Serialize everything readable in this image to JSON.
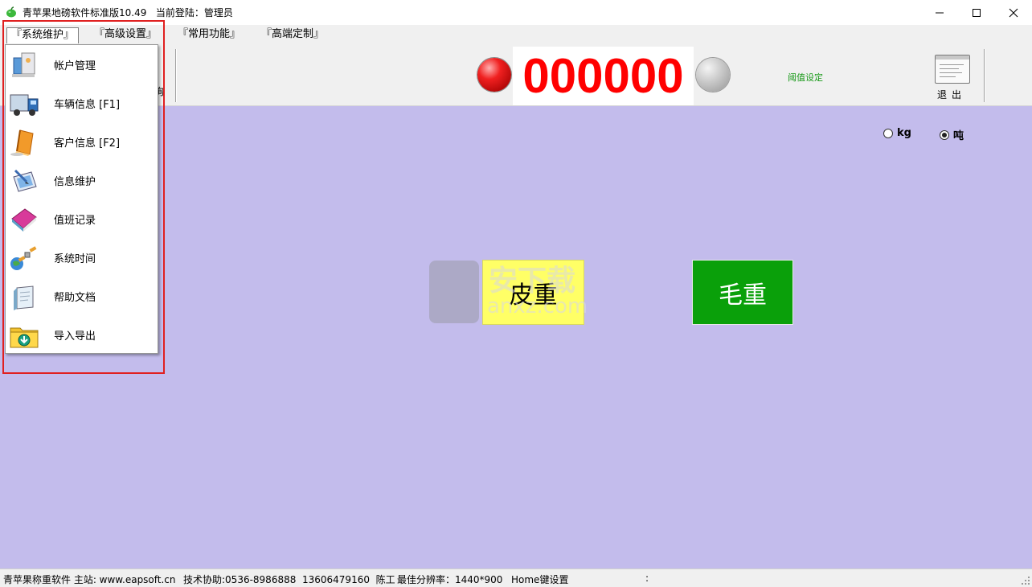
{
  "window": {
    "title": "青苹果地磅软件标准版10.49",
    "login_label": "当前登陆：管理员"
  },
  "menu": {
    "items": [
      {
        "label": "『系统维护』"
      },
      {
        "label": "『高级设置』"
      },
      {
        "label": "『常用功能』"
      },
      {
        "label": "『高端定制』"
      }
    ]
  },
  "toolbar": {
    "partial_label": "询",
    "weight_display": "000000",
    "threshold_label": "阈值设定",
    "exit_label": "退出"
  },
  "dropdown": {
    "items": [
      {
        "label": "帐户管理",
        "icon": "account-icon"
      },
      {
        "label": "车辆信息 [F1]",
        "icon": "truck-icon"
      },
      {
        "label": "客户信息 [F2]",
        "icon": "customer-book-icon"
      },
      {
        "label": "信息维护",
        "icon": "edit-info-icon"
      },
      {
        "label": "值班记录",
        "icon": "duty-book-icon"
      },
      {
        "label": "系统时间",
        "icon": "satellite-icon"
      },
      {
        "label": "帮助文档",
        "icon": "help-doc-icon"
      },
      {
        "label": "导入导出",
        "icon": "folder-import-icon"
      }
    ]
  },
  "main": {
    "unit_options": [
      {
        "label": "kg",
        "checked": false
      },
      {
        "label": "吨",
        "checked": true
      }
    ],
    "tare_label": "皮重",
    "gross_label": "毛重",
    "watermark": {
      "text": "安下载",
      "sub": "anxz.com"
    }
  },
  "status": {
    "company": "青苹果称重软件 主站: www.eapsoft.cn",
    "support": "技术协助:0536-8986888  13606479160  陈工",
    "resolution": "最佳分辨率：1440*900",
    "home_key": "Home键设置",
    "extra": ":"
  },
  "colors": {
    "main_bg": "#c3bcec",
    "weight_red": "#ff0000",
    "tare_yellow": "#ffff66",
    "gross_green": "#0aa00a",
    "highlight_red": "#e02020"
  }
}
